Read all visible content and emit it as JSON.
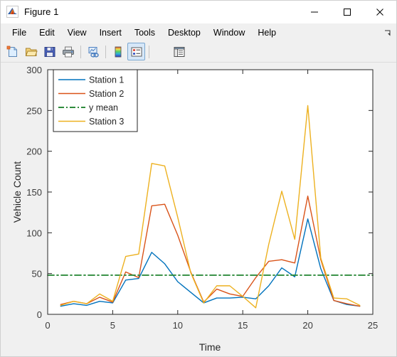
{
  "window": {
    "title": "Figure 1",
    "app_icon": "matlab-membrane-icon",
    "controls": {
      "minimize": "minimize-icon",
      "maximize": "maximize-icon",
      "close": "close-icon"
    }
  },
  "menubar": {
    "items": [
      {
        "label": "File"
      },
      {
        "label": "Edit"
      },
      {
        "label": "View"
      },
      {
        "label": "Insert"
      },
      {
        "label": "Tools"
      },
      {
        "label": "Desktop"
      },
      {
        "label": "Window"
      },
      {
        "label": "Help"
      }
    ],
    "resize_grip": "resize-grip-icon"
  },
  "toolbar": {
    "buttons": [
      {
        "name": "new-figure-button",
        "icon": "new-document-icon",
        "active": false,
        "title": "New Figure"
      },
      {
        "name": "open-file-button",
        "icon": "open-folder-icon",
        "active": false,
        "title": "Open File"
      },
      {
        "name": "save-figure-button",
        "icon": "save-floppy-icon",
        "active": false,
        "title": "Save Figure"
      },
      {
        "name": "print-figure-button",
        "icon": "printer-icon",
        "active": false,
        "title": "Print Figure"
      },
      {
        "name": "separator-1",
        "icon": "separator",
        "active": false,
        "title": ""
      },
      {
        "name": "link-plot-button",
        "icon": "link-plot-icon",
        "active": false,
        "title": "Link Plot"
      },
      {
        "name": "separator-2",
        "icon": "separator",
        "active": false,
        "title": ""
      },
      {
        "name": "colorbar-button",
        "icon": "colorbar-icon",
        "active": false,
        "title": "Insert Colorbar"
      },
      {
        "name": "legend-button",
        "icon": "legend-icon",
        "active": true,
        "title": "Insert Legend"
      },
      {
        "name": "separator-3",
        "icon": "separator",
        "active": false,
        "title": ""
      },
      {
        "name": "show-plot-tools-button",
        "icon": "plot-tools-icon",
        "active": false,
        "title": "Show Plot Tools"
      }
    ],
    "cursor": "mouse-pointer-icon"
  },
  "chart_data": {
    "type": "line",
    "title": "",
    "xlabel": "Time",
    "ylabel": "Vehicle Count",
    "xlim": [
      0,
      25
    ],
    "ylim": [
      0,
      300
    ],
    "xticks": [
      0,
      5,
      10,
      15,
      20,
      25
    ],
    "yticks": [
      0,
      50,
      100,
      150,
      200,
      250,
      300
    ],
    "grid": false,
    "legend_position": "top-left",
    "background": "#ffffff",
    "x": [
      1,
      2,
      3,
      4,
      5,
      6,
      7,
      8,
      9,
      10,
      11,
      12,
      13,
      14,
      15,
      16,
      17,
      18,
      19,
      20,
      21,
      22,
      23,
      24
    ],
    "series": [
      {
        "name": "Station 1",
        "color": "#0072BD",
        "style": "solid",
        "values": [
          10,
          13,
          11,
          16,
          14,
          42,
          44,
          76,
          62,
          40,
          27,
          14,
          20,
          20,
          21,
          19,
          35,
          57,
          46,
          117,
          56,
          17,
          12,
          10
        ]
      },
      {
        "name": "Station 2",
        "color": "#D95319",
        "style": "solid",
        "values": [
          12,
          16,
          13,
          21,
          15,
          52,
          45,
          133,
          135,
          97,
          52,
          15,
          31,
          25,
          22,
          45,
          65,
          67,
          63,
          145,
          67,
          17,
          13,
          10
        ]
      },
      {
        "name": "y mean",
        "color": "#2E8B3C",
        "style": "dashdot",
        "constant": 48,
        "values": [
          48,
          48,
          48,
          48,
          48,
          48,
          48,
          48,
          48,
          48,
          48,
          48,
          48,
          48,
          48,
          48,
          48,
          48,
          48,
          48,
          48,
          48,
          48,
          48
        ]
      },
      {
        "name": "Station 3",
        "color": "#EDB120",
        "style": "solid",
        "values": [
          11,
          16,
          13,
          25,
          16,
          71,
          74,
          185,
          182,
          119,
          51,
          14,
          35,
          35,
          22,
          8,
          86,
          151,
          92,
          256,
          69,
          20,
          19,
          11
        ]
      }
    ]
  }
}
